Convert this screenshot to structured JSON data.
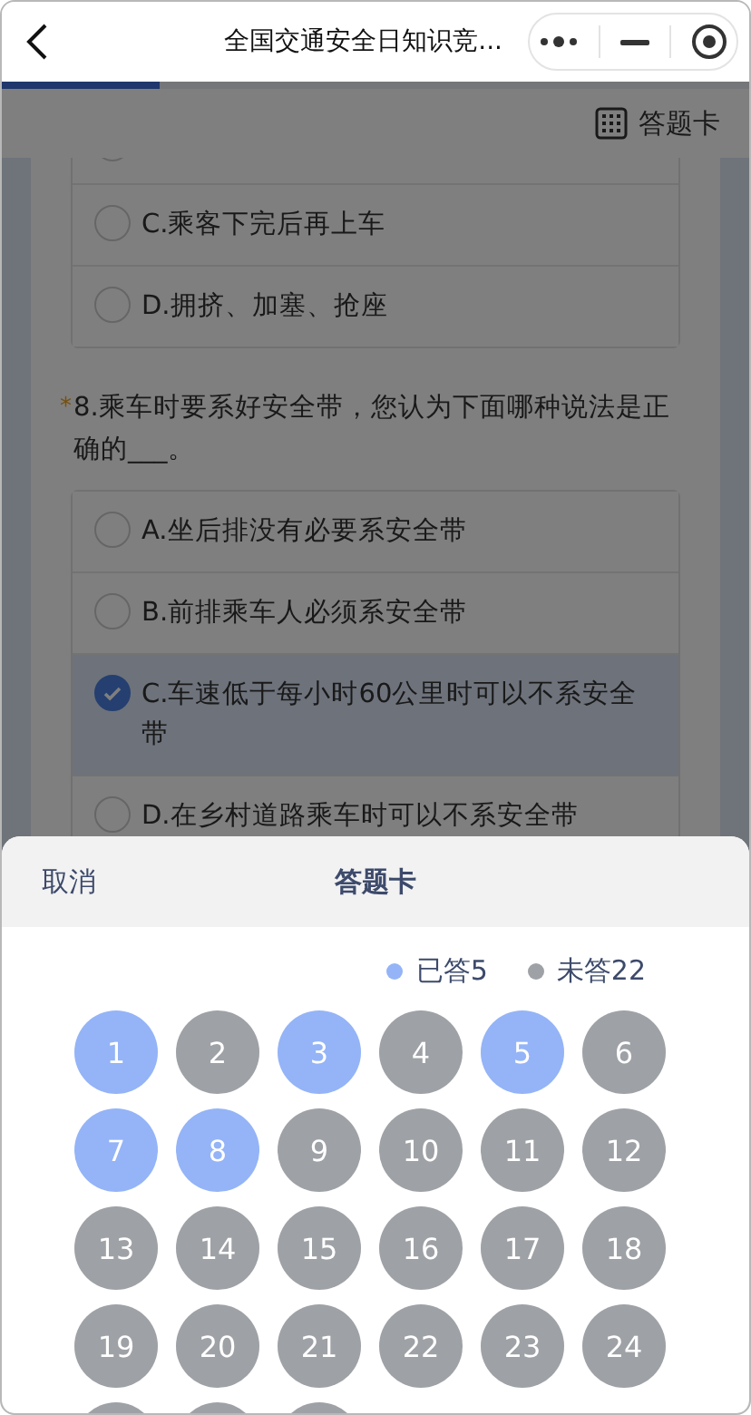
{
  "header": {
    "title": "全国交通安全日知识竞..."
  },
  "progress": {
    "level": 0.21
  },
  "toolbar": {
    "answer_card_label": "答题卡"
  },
  "previous_options": [
    {
      "selected": false
    },
    {
      "label": "C.乘客下完后再上车",
      "selected": false
    },
    {
      "label": "D.拥挤、加塞、抢座",
      "selected": false
    }
  ],
  "question": {
    "required_mark": "*",
    "text": "8.乘车时要系好安全带，您认为下面哪种说法是正确的___。",
    "options": [
      {
        "label": "A.坐后排没有必要系安全带",
        "selected": false
      },
      {
        "label": "B.前排乘车人必须系安全带",
        "selected": false
      },
      {
        "label": "C.车速低于每小时60公里时可以不系安全带",
        "selected": true
      },
      {
        "label": "D.在乡村道路乘车时可以不系安全带",
        "selected": false
      }
    ]
  },
  "sheet": {
    "cancel": "取消",
    "title": "答题卡",
    "legend": [
      {
        "label": "已答5",
        "color": "#94b4f7"
      },
      {
        "label": "未答22",
        "color": "#9ea1a5"
      }
    ],
    "numbers": [
      {
        "label": "1",
        "answered": true
      },
      {
        "label": "2",
        "answered": false
      },
      {
        "label": "3",
        "answered": true
      },
      {
        "label": "4",
        "answered": false
      },
      {
        "label": "5",
        "answered": true
      },
      {
        "label": "6",
        "answered": false
      },
      {
        "label": "7",
        "answered": true
      },
      {
        "label": "8",
        "answered": true
      },
      {
        "label": "9",
        "answered": false
      },
      {
        "label": "10",
        "answered": false
      },
      {
        "label": "11",
        "answered": false
      },
      {
        "label": "12",
        "answered": false
      },
      {
        "label": "13",
        "answered": false
      },
      {
        "label": "14",
        "answered": false
      },
      {
        "label": "15",
        "answered": false
      },
      {
        "label": "16",
        "answered": false
      },
      {
        "label": "17",
        "answered": false
      },
      {
        "label": "18",
        "answered": false
      },
      {
        "label": "19",
        "answered": false
      },
      {
        "label": "20",
        "answered": false
      },
      {
        "label": "21",
        "answered": false
      },
      {
        "label": "22",
        "answered": false
      },
      {
        "label": "23",
        "answered": false
      },
      {
        "label": "24",
        "answered": false
      },
      {
        "answered": false
      },
      {
        "answered": false
      },
      {
        "answered": false
      }
    ]
  }
}
